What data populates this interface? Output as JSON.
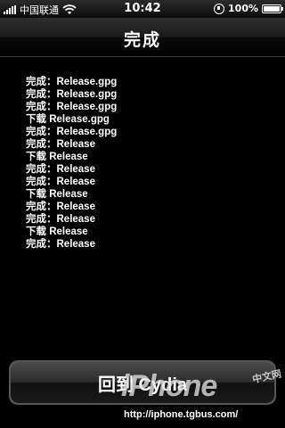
{
  "statusbar": {
    "carrier": "中国联通",
    "time": "10:42",
    "battery": "100%",
    "battery_level": 1.0
  },
  "navbar": {
    "title": "完成"
  },
  "log": [
    "完成：Release.gpg",
    "完成：Release.gpg",
    "完成：Release.gpg",
    "下载 Release.gpg",
    "完成：Release.gpg",
    "完成：Release",
    "下载 Release",
    "完成：Release",
    "完成：Release",
    "下载 Release",
    "完成：Release",
    "完成：Release",
    "下载 Release",
    "完成：Release"
  ],
  "return_button": {
    "label": "回到 Cydia"
  },
  "watermark": {
    "brand": "iPhone",
    "tag": "中文网",
    "url": "http://iphone.tgbus.com/"
  }
}
